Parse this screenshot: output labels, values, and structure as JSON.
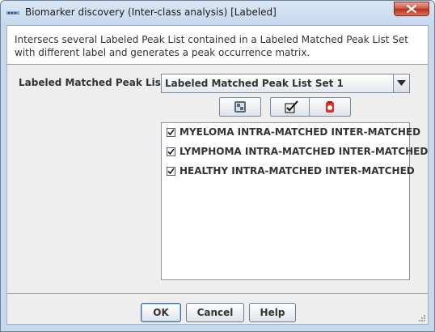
{
  "window": {
    "title": "Biomarker discovery (Inter-class analysis) [Labeled]"
  },
  "description": "Intersecs several Labeled Peak List contained in a Labeled Matched Peak List Set with different label and generates a peak occurrence matrix.",
  "form": {
    "lists_label": "Labeled Matched Peak Lists",
    "combo_value": "Labeled Matched Peak List Set 1"
  },
  "list": {
    "items": [
      {
        "label": "MYELOMA INTRA-MATCHED INTER-MATCHED",
        "checked": true
      },
      {
        "label": "LYMPHOMA INTRA-MATCHED INTER-MATCHED",
        "checked": true
      },
      {
        "label": "HEALTHY INTRA-MATCHED INTER-MATCHED",
        "checked": true
      }
    ]
  },
  "toolbar": {
    "icons": [
      "select-all-icon",
      "check-icon",
      "clear-selection-icon"
    ]
  },
  "buttons": {
    "ok": "OK",
    "cancel": "Cancel",
    "help": "Help"
  }
}
